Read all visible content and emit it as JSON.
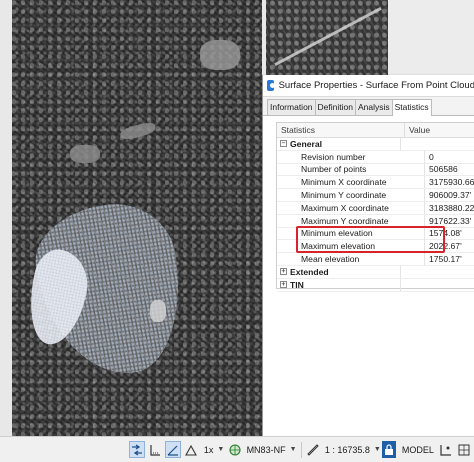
{
  "dialog": {
    "title": "Surface Properties - Surface From Point Cloud",
    "tabs": [
      {
        "label": "Information"
      },
      {
        "label": "Definition"
      },
      {
        "label": "Analysis"
      },
      {
        "label": "Statistics",
        "active": true
      }
    ],
    "table": {
      "columns": {
        "name": "Statistics",
        "value": "Value"
      },
      "groups": [
        {
          "label": "General",
          "expanded": true,
          "rows": [
            {
              "name": "Revision number",
              "value": "0"
            },
            {
              "name": "Number of points",
              "value": "506586"
            },
            {
              "name": "Minimum X coordinate",
              "value": "3175930.66'"
            },
            {
              "name": "Minimum Y coordinate",
              "value": "906009.37'"
            },
            {
              "name": "Maximum X coordinate",
              "value": "3183880.22'"
            },
            {
              "name": "Maximum Y coordinate",
              "value": "917622.33'"
            },
            {
              "name": "Minimum elevation",
              "value": "1574.08'",
              "highlighted": true
            },
            {
              "name": "Maximum elevation",
              "value": "2022.67'",
              "highlighted": true
            },
            {
              "name": "Mean elevation",
              "value": "1750.17'"
            }
          ]
        },
        {
          "label": "Extended",
          "expanded": false
        },
        {
          "label": "TIN",
          "expanded": false
        }
      ]
    },
    "highlight_color": "#d8232a"
  },
  "statusbar": {
    "zoom": "1x",
    "coordinate_system": "MN83-NF",
    "scale": "1 : 16735.8",
    "space": "MODEL",
    "icons": [
      "selection-cycle-icon",
      "dimension-icon",
      "angle-icon",
      "polar-icon",
      "zoom-ratio-icon",
      "coordinate-system-icon",
      "scale-icon",
      "lock-icon",
      "model-space-icon",
      "ortho-icon",
      "snap-icon"
    ]
  }
}
